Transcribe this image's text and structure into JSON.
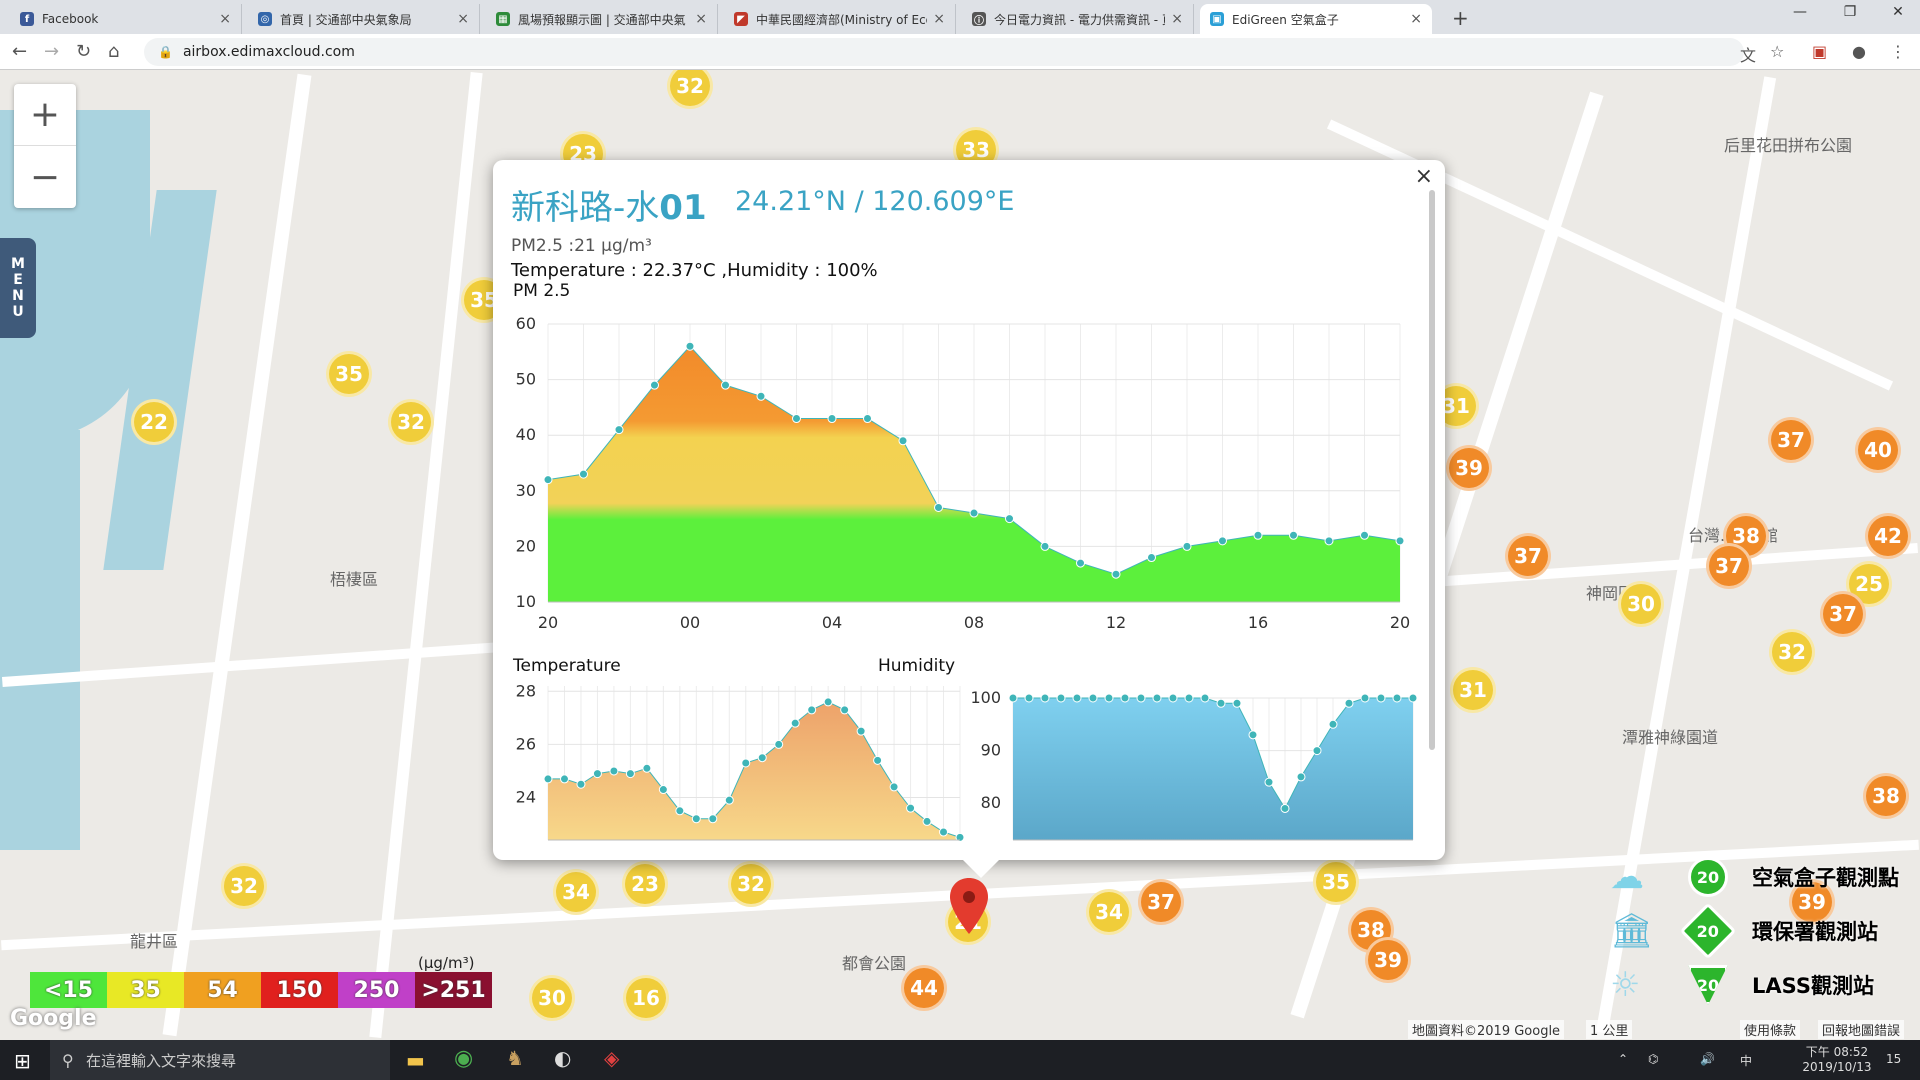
{
  "browser": {
    "tabs": [
      {
        "label": "Facebook",
        "color": "#3b5998",
        "glyph": "f"
      },
      {
        "label": "首頁 | 交通部中央氣象局",
        "color": "#3366aa",
        "glyph": "◎"
      },
      {
        "label": "風場預報顯示圖 | 交通部中央氣",
        "color": "#2e8b3a",
        "glyph": "▦"
      },
      {
        "label": "中華民國經濟部(Ministry of Eco",
        "color": "#c0392b",
        "glyph": "◤"
      },
      {
        "label": "今日電力資訊 - 電力供需資訊 - 頁",
        "color": "#555555",
        "glyph": "ⓘ"
      },
      {
        "label": "EdiGreen 空氣盒子",
        "color": "#2a9fd6",
        "glyph": "▣"
      }
    ],
    "url": "airbox.edimaxcloud.com"
  },
  "map": {
    "labels": [
      {
        "text": "梧棲區"
      },
      {
        "text": "龍井區"
      },
      {
        "text": "神岡區"
      },
      {
        "text": "潭雅神綠園道"
      },
      {
        "text": "都會公園"
      },
      {
        "text": "后里花田拼布公園"
      },
      {
        "text": "台灣..博物館"
      }
    ],
    "markers": [
      {
        "v": "32",
        "c": "y"
      },
      {
        "v": "23",
        "c": "y"
      },
      {
        "v": "33",
        "c": "y"
      },
      {
        "v": "35",
        "c": "y"
      },
      {
        "v": "22",
        "c": "y"
      },
      {
        "v": "32",
        "c": "y"
      },
      {
        "v": "35",
        "c": "y"
      },
      {
        "v": "31",
        "c": "y"
      },
      {
        "v": "39",
        "c": "o"
      },
      {
        "v": "37",
        "c": "o"
      },
      {
        "v": "40",
        "c": "o"
      },
      {
        "v": "37",
        "c": "o"
      },
      {
        "v": "38",
        "c": "o"
      },
      {
        "v": "37",
        "c": "o"
      },
      {
        "v": "42",
        "c": "o"
      },
      {
        "v": "30",
        "c": "y"
      },
      {
        "v": "25",
        "c": "y"
      },
      {
        "v": "37",
        "c": "o"
      },
      {
        "v": "32",
        "c": "y"
      },
      {
        "v": "31",
        "c": "y"
      },
      {
        "v": "38",
        "c": "o"
      },
      {
        "v": "32",
        "c": "y"
      },
      {
        "v": "34",
        "c": "y"
      },
      {
        "v": "23",
        "c": "y"
      },
      {
        "v": "32",
        "c": "y"
      },
      {
        "v": "21",
        "c": "y"
      },
      {
        "v": "34",
        "c": "y"
      },
      {
        "v": "37",
        "c": "o"
      },
      {
        "v": "35",
        "c": "y"
      },
      {
        "v": "38",
        "c": "o"
      },
      {
        "v": "39",
        "c": "o"
      },
      {
        "v": "44",
        "c": "o"
      },
      {
        "v": "30",
        "c": "y"
      },
      {
        "v": "16",
        "c": "y"
      },
      {
        "v": "39",
        "c": "o"
      }
    ],
    "legend": [
      {
        "label": "<15",
        "color": "#4ee63b"
      },
      {
        "label": "35",
        "color": "#e8e825"
      },
      {
        "label": "54",
        "color": "#f0a020"
      },
      {
        "label": "150",
        "color": "#e0201e"
      },
      {
        "label": "250",
        "color": "#c040c8"
      },
      {
        "label": ">251",
        "color": "#8a1030"
      }
    ],
    "unit": "(μg/m³)",
    "google": "Google",
    "attribution": "地圖資料©2019 Google",
    "scale": "1 公里",
    "terms": "使用條款",
    "report": "回報地圖錯誤",
    "menu_letters": [
      "M",
      "E",
      "N",
      "U"
    ],
    "side_legend": [
      {
        "label": "空氣盒子觀測點",
        "badge": "20"
      },
      {
        "label": "環保署觀測站",
        "badge": "20"
      },
      {
        "label": "LASS觀測站",
        "badge": "20"
      }
    ]
  },
  "popup": {
    "title_main": "新科路-水",
    "title_num": "01",
    "coords": "24.21°N / 120.609°E",
    "pm": "PM2.5 :21 μg/m³",
    "temp_hum": "Temperature : 22.37°C ,Humidity : 100%",
    "close": "×"
  },
  "chart_data": [
    {
      "type": "area",
      "title": "PM 2.5",
      "x_ticks": [
        "20",
        "00",
        "04",
        "08",
        "12",
        "16",
        "20"
      ],
      "yticks": [
        10,
        20,
        30,
        40,
        50,
        60
      ],
      "ylim": [
        10,
        60
      ],
      "grid": true,
      "values": [
        32,
        33,
        41,
        49,
        56,
        49,
        47,
        43,
        43,
        43,
        39,
        27,
        26,
        25,
        20,
        17,
        15,
        18,
        20,
        21,
        22,
        22,
        21,
        22,
        21
      ]
    },
    {
      "type": "area",
      "title": "Temperature",
      "yticks": [
        24,
        26,
        28
      ],
      "ylim": [
        22.4,
        28.2
      ],
      "grid": true,
      "values": [
        24.7,
        24.7,
        24.5,
        24.9,
        25.0,
        24.9,
        25.1,
        24.3,
        23.5,
        23.2,
        23.2,
        23.9,
        25.3,
        25.5,
        26.0,
        26.8,
        27.3,
        27.6,
        27.3,
        26.5,
        25.4,
        24.4,
        23.6,
        23.1,
        22.7,
        22.5
      ]
    },
    {
      "type": "area",
      "title": "Humidity",
      "yticks": [
        80,
        90,
        100
      ],
      "ylim": [
        73,
        100
      ],
      "grid": true,
      "values": [
        100,
        100,
        100,
        100,
        100,
        100,
        100,
        100,
        100,
        100,
        100,
        100,
        100,
        99,
        99,
        93,
        84,
        79,
        85,
        90,
        95,
        99,
        100,
        100,
        100,
        100
      ]
    }
  ],
  "taskbar": {
    "search": "在這裡輸入文字來搜尋",
    "time": "下午 08:52",
    "date": "2019/10/13",
    "ime": "中",
    "notif": "15"
  }
}
